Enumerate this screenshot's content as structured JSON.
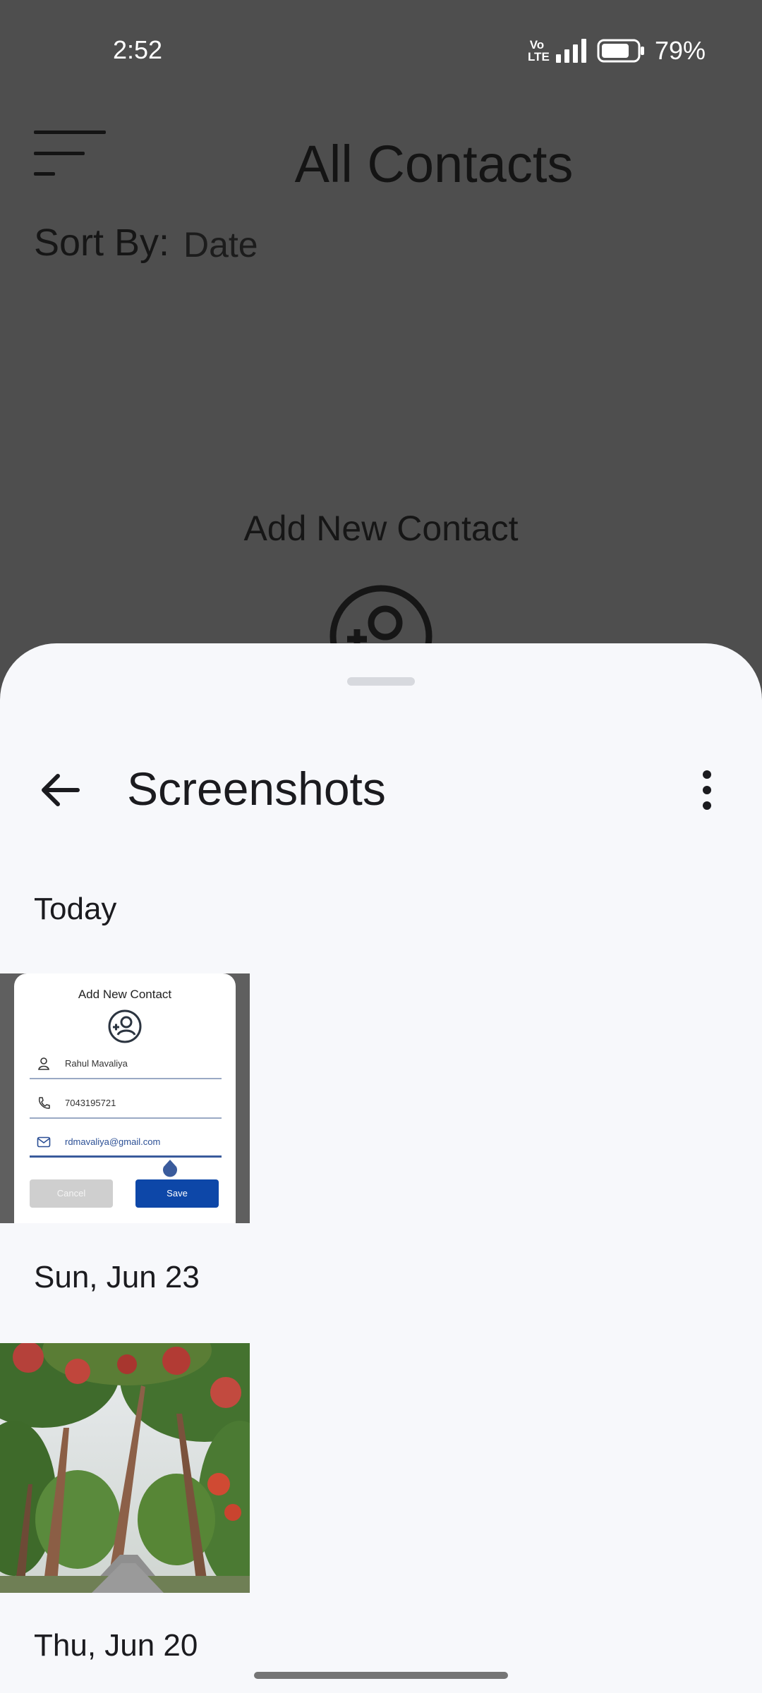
{
  "status_bar": {
    "time": "2:52",
    "network_badge_top": "Vo",
    "network_badge_bottom": "LTE",
    "battery_percent": "79%",
    "battery_level": 0.79
  },
  "background_app": {
    "title": "All Contacts",
    "sort_label": "Sort By:",
    "sort_value": "Date",
    "add_new_contact": "Add New Contact"
  },
  "sheet": {
    "title": "Screenshots",
    "groups": [
      {
        "date": "Today",
        "thumbnail": {
          "kind": "screenshot",
          "card_title": "Add New Contact",
          "name": "Rahul Mavaliya",
          "phone": "7043195721",
          "email": "rdmavaliya@gmail.com",
          "cancel_label": "Cancel",
          "save_label": "Save"
        }
      },
      {
        "date": "Sun, Jun 23",
        "thumbnail": {
          "kind": "photo"
        }
      },
      {
        "date": "Thu, Jun 20"
      }
    ]
  },
  "colors": {
    "scrim": "#4e4e4e",
    "sheet_bg": "#f7f8fb",
    "save_button": "#0d47a8"
  },
  "icons": [
    "menu-icon",
    "add-contact-icon",
    "back-arrow-icon",
    "more-vert-icon",
    "signal-icon",
    "battery-icon"
  ]
}
